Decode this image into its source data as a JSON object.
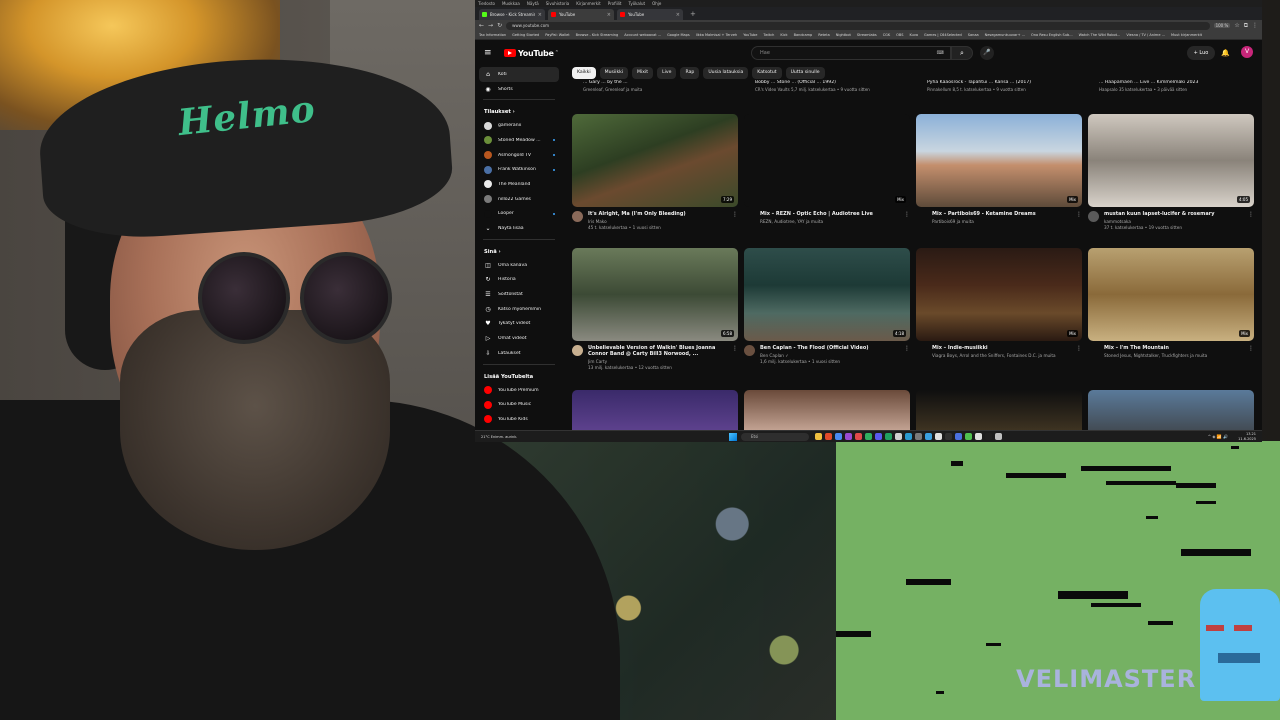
{
  "browser": {
    "menu": [
      "Tiedosto",
      "Muokkaa",
      "Näytä",
      "Sivuhistoria",
      "Kirjanmerkit",
      "Profiilit",
      "Työkalut",
      "Ohje"
    ],
    "tabs": [
      {
        "label": "Browse - Kick Streaming",
        "color": "#53fc18",
        "active": false
      },
      {
        "label": "YouTube",
        "color": "#ff0000",
        "active": true
      },
      {
        "label": "YouTube",
        "color": "#ff0000",
        "active": false
      }
    ],
    "url": "www.youtube.com",
    "zoom": "100 %",
    "bookmarks": [
      "Tax Information",
      "Getting Started",
      "PayPal: Wallet",
      "Browse - Kick Streaming",
      "Account weboavat ...",
      "Google Maps",
      "Ilkka Malmisal + Terveh",
      "YouTube",
      "Twitch",
      "Kick",
      "Bandcamp",
      "Reteta",
      "Nightbot",
      "Streamlabs",
      "CGK",
      "OBS",
      "Kuva",
      "Games | C64Selected",
      "Sanaa",
      "Nesegamunkuuvar+ ...",
      "Ono Resu English Sub...",
      "Watch The Wild Robot...",
      "Viesna / TV / Anime ...",
      "Muut kirjanmerkit"
    ]
  },
  "yt": {
    "logo_text": "YouTube",
    "logo_cc": "FI",
    "search_placeholder": "Hae",
    "create_label": "+ Luo",
    "avatar_letter": "V",
    "nav": [
      {
        "label": "Koti",
        "icon": "⌂",
        "active": true
      },
      {
        "label": "Shorts",
        "icon": "◉",
        "active": false
      }
    ],
    "subs_heading": "Tilaukset ›",
    "subs": [
      {
        "label": "gameranx",
        "color": "#d9d9d9",
        "dot": false
      },
      {
        "label": "Stoned Meadow ...",
        "color": "#6b8f3a",
        "dot": true
      },
      {
        "label": "Asmongold TV",
        "color": "#b8571f",
        "dot": true
      },
      {
        "label": "Frank Watkinson",
        "color": "#4a6fa5",
        "dot": true
      },
      {
        "label": "The Meänland",
        "color": "#eaeaea",
        "dot": false
      },
      {
        "label": "nillo22 Games",
        "color": "#7a7a7a",
        "dot": false
      },
      {
        "label": "Looper",
        "color": "#0f0f0f",
        "dot": true
      }
    ],
    "show_more": "Näytä lisää",
    "you_heading": "Sinä ›",
    "you_items": [
      {
        "label": "Oma kanava",
        "icon": "◫"
      },
      {
        "label": "Historia",
        "icon": "↻"
      },
      {
        "label": "Soittolistat",
        "icon": "☰"
      },
      {
        "label": "Katso myöhemmin",
        "icon": "◷"
      },
      {
        "label": "Tykätyt videot",
        "icon": "♥"
      },
      {
        "label": "Omat videot",
        "icon": "▷"
      },
      {
        "label": "Lataukset",
        "icon": "⇩"
      }
    ],
    "more_heading": "Lisää YouTubelta",
    "more_items": [
      {
        "label": "YouTube Premium",
        "color": "#ff0000"
      },
      {
        "label": "YouTube Music",
        "color": "#ff0000"
      },
      {
        "label": "YouTube Kids",
        "color": "#ff0000"
      }
    ],
    "chips": [
      {
        "label": "Kaikki",
        "active": true
      },
      {
        "label": "Musiikki",
        "active": false
      },
      {
        "label": "Mixit",
        "active": false
      },
      {
        "label": "Live",
        "active": false
      },
      {
        "label": "Rap",
        "active": false
      },
      {
        "label": "Uusia latauksia",
        "active": false
      },
      {
        "label": "Katsotut",
        "active": false
      },
      {
        "label": "Uutta sinulle",
        "active": false
      }
    ],
    "top_row": [
      {
        "title": "... Gary ... by the ...",
        "meta": "Greenleaf, Greenleaf ja muita"
      },
      {
        "title": "Bobby ... Stone ... (Official ... 1992)",
        "meta": "CR's Video Vaults  5,7 milj. katselukertaa • 9 vuotta sitten"
      },
      {
        "title": "Pyhä Kaaosrock - Tapahtui ... Kansa ... (2017)",
        "meta": "Pinnakellum  8,5 t. katselukertaa • 9 vuotta sitten"
      },
      {
        "title": "... Haapamäen ... Live ... Kimmelmäki 2023",
        "meta": "Haapsalo  35 katselukertaa • 3 päivää sitten"
      }
    ],
    "videos": [
      {
        "title": "It's Alright, Ma (I'm Only Bleeding)",
        "channel": "Iris Mako",
        "stats": "45 t. katselukertaa • 1 vuosi sitten",
        "duration": "7:29",
        "thumb": "linear-gradient(160deg,#4f6a3a,#2d3e22 40%,#6b4a2f 60%,#3b4a2a)",
        "av": "#8a6a5a"
      },
      {
        "title": "Mix – REZN - Optic Echo | Audiotree Live",
        "channel": "REZN, Audiotree, YAY ja muita",
        "stats": "",
        "duration": "Mix",
        "thumb": "#0f0f0f",
        "av": ""
      },
      {
        "title": "Mix – Partibois69 - Ketamine Dreams",
        "channel": "Partibois69 ja muita",
        "stats": "",
        "duration": "Mix",
        "thumb": "linear-gradient(180deg,#8bb0d8,#c9d6e0 40%,#c48f6d 55%,#5e4b3a)",
        "av": ""
      },
      {
        "title": "mustan kuun lapset-lucifer & rosemary",
        "channel": "kammotsaka",
        "stats": "37 t. katselukertaa • 19 vuotta sitten",
        "duration": "4:05",
        "thumb": "linear-gradient(180deg,#cfc8bf,#8a837a 50%,#d8d2ca)",
        "av": "#5a5a5a"
      },
      {
        "title": "Unbelievable Version of Walkin' Blues Joanna Connor Band @ Carty Bill3 Norwood, ...",
        "channel": "Jim Carty",
        "stats": "13 milj. katselukertaa • 12 vuotta sitten",
        "duration": "6:58",
        "thumb": "linear-gradient(180deg,#6a7a5a,#3c4a35 50%,#8a8a80)",
        "av": "#c8b090"
      },
      {
        "title": "Ben Caplan - The Flood (Official Video)",
        "channel": "Ben Caplan ✓",
        "stats": "1,6 milj. katselukertaa • 1 vuosi sitten",
        "duration": "4:18",
        "thumb": "linear-gradient(180deg,#2e4d4a,#1d3a36 40%,#4e6a62 70%,#6a5a4a)",
        "av": "#6a5040"
      },
      {
        "title": "Mix – Indie-musiikki",
        "channel": "Viagra Boys, Arrol and the Sniffers, Fontaines D.C. ja muita",
        "stats": "",
        "duration": "Mix",
        "thumb": "linear-gradient(180deg,#2a1a14,#4a2a1a 40%,#6a4a2a 70%,#2a1a12)",
        "av": ""
      },
      {
        "title": "Mix – I'm The Mountain",
        "channel": "Stoned Jesus, Nightstalker, Truckfighters ja muita",
        "stats": "",
        "duration": "Mix",
        "thumb": "linear-gradient(180deg,#b8a070,#8a6a3a 50%,#c8b080)",
        "av": ""
      }
    ],
    "bottom_row": [
      {
        "thumb": "linear-gradient(180deg,#3a2a6a,#6a4a9a 60%,#2a1a3a)"
      },
      {
        "thumb": "linear-gradient(180deg,#6a4a3a,#d0b0a0 50%,#f0e0e8)"
      },
      {
        "thumb": "linear-gradient(180deg,#0f0f0f,#3a3020 40%,#8a7040)"
      },
      {
        "thumb": "linear-gradient(180deg,#5a7a9a,#3a3a3a 60%)"
      }
    ]
  },
  "taskbar": {
    "weather": "21°C Enimm. aurink.",
    "search": "Etsi",
    "time": "13.21",
    "date": "11.6.2025",
    "tray": "^ ◈ 📶 🔊"
  },
  "game": {
    "logo": "VELIMASTER"
  },
  "webcam": {
    "cap_text": "Helmo"
  }
}
